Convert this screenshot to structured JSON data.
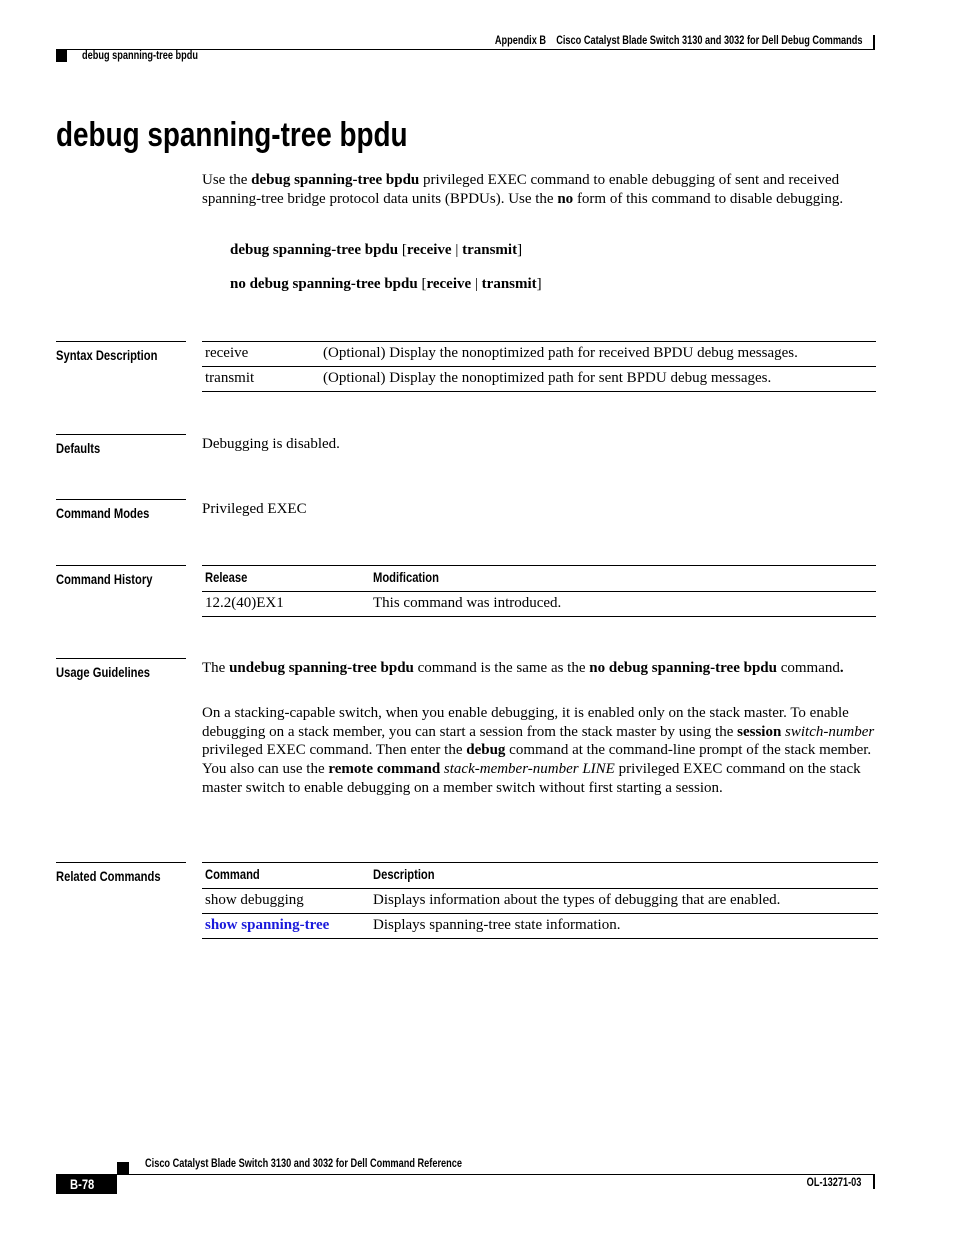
{
  "header": {
    "appendix": "Appendix B",
    "chapter_title": "Cisco Catalyst Blade Switch 3130 and 3032 for Dell Debug Commands",
    "running_head": "debug spanning-tree bpdu"
  },
  "title": "debug spanning-tree bpdu",
  "intro": {
    "p1": "Use the ",
    "p1_bold": "debug spanning-tree bpdu",
    "p2": " privileged EXEC command to enable debugging of sent and received spanning-tree bridge protocol data units (BPDUs). Use the ",
    "p2_bold": "no",
    "p3": " form of this command to disable debugging."
  },
  "syntax": {
    "line1": {
      "cmd": "debug spanning-tree bpdu",
      "open": " [",
      "opt1": "receive",
      "sep": " | ",
      "opt2": "transmit",
      "close": "]"
    },
    "line2": {
      "cmd": "no debug spanning-tree bpdu",
      "open": " [",
      "opt1": "receive",
      "sep": " | ",
      "opt2": "transmit",
      "close": "]"
    }
  },
  "syntax_description": {
    "label": "Syntax Description",
    "rows": [
      {
        "keyword": "receive",
        "description": "(Optional) Display the nonoptimized path for received BPDU debug messages."
      },
      {
        "keyword": "transmit",
        "description": "(Optional) Display the nonoptimized path for sent BPDU debug messages."
      }
    ]
  },
  "defaults": {
    "label": "Defaults",
    "text": "Debugging is disabled."
  },
  "command_modes": {
    "label": "Command Modes",
    "text": "Privileged EXEC"
  },
  "command_history": {
    "label": "Command History",
    "headers": [
      "Release",
      "Modification"
    ],
    "rows": [
      {
        "release": "12.2(40)EX1",
        "modification": "This command was introduced."
      }
    ]
  },
  "usage_guidelines": {
    "label": "Usage Guidelines",
    "para1": {
      "t1": "The ",
      "b1": "undebug spanning-tree bpdu",
      "t2": " command is the same as the ",
      "b2": "no debug spanning-tree bpdu",
      "t3": " command",
      "b3": "."
    },
    "para2": {
      "t1": "On a stacking-capable switch, when you enable debugging, it is enabled only on the stack master. To enable debugging on a stack member, you can start a session from the stack master by using the ",
      "b1": "session",
      "i1": "switch-number",
      "t2": " privileged EXEC command. Then enter the ",
      "b2": "debug",
      "t3": " command at the command-line prompt of the stack member. You also can use the ",
      "b3": "remote command",
      "i2": "stack-member-number LINE",
      "t4": " privileged EXEC command on the stack master switch to enable debugging on a member switch without first starting a session."
    }
  },
  "related_commands": {
    "label": "Related Commands",
    "headers": [
      "Command",
      "Description"
    ],
    "rows": [
      {
        "command": "show debugging",
        "description": "Displays information about the types of debugging that are enabled.",
        "is_link": false
      },
      {
        "command": "show spanning-tree",
        "description": "Displays spanning-tree state information.",
        "is_link": true
      }
    ],
    "link_color": "#1a1adb"
  },
  "footer": {
    "book_title": "Cisco Catalyst Blade Switch 3130 and 3032 for Dell Command Reference",
    "page_number": "B-78",
    "doc_number": "OL-13271-03"
  }
}
